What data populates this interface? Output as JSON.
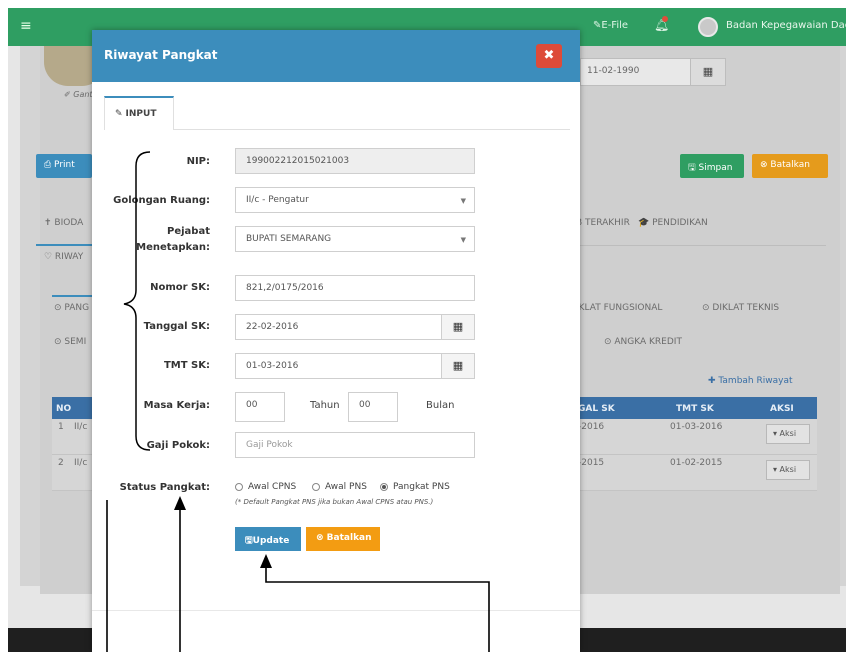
{
  "topbar": {
    "menu_icon": "hamburger-icon",
    "efile_label": "✎E-File",
    "bell_icon": "bell-icon",
    "org_name": "Badan Kepegawaian Daerah"
  },
  "background": {
    "ganti_label": "✐ Gant",
    "date_value": "11-02-1990",
    "print_label": "⎙ Print",
    "simpan_label": "🖫 Simpan",
    "batalkan_label": "⊗ Batalkan",
    "tabs_row1": {
      "biodata": "✝ BIODA",
      "terakhir": "B TERAKHIR",
      "pendidikan": "🎓 PENDIDIKAN"
    },
    "tabs_row2": {
      "riwayat": "♡ RIWAY"
    },
    "tabs_row3": {
      "pangkat": "⊙ PANG",
      "diklat_fungsional": "IKLAT FUNGSIONAL",
      "diklat_teknis": "⊙ DIKLAT TEKNIS"
    },
    "tabs_row4": {
      "seminar": "⊙ SEMI",
      "angka_kredit": "⊙ ANGKA KREDIT"
    },
    "tambah_riwayat": "✚ Tambah Riwayat",
    "table_headers": {
      "no": "NO",
      "tgl_sk": "GAL SK",
      "tmt_sk": "TMT SK",
      "aksi": "AKSI"
    },
    "rows": [
      {
        "no": "1",
        "gol": "II/c",
        "tgl": "-2016",
        "tmt": "01-03-2016",
        "aksi": "▾ Aksi"
      },
      {
        "no": "2",
        "gol": "II/c",
        "tgl": "-2015",
        "tmt": "01-02-2015",
        "aksi": "▾ Aksi"
      }
    ]
  },
  "modal": {
    "title": "Riwayat Pangkat",
    "close_label": "✖",
    "tab_input": "INPUT",
    "fields": {
      "nip": {
        "label": "NIP:",
        "value": "199002212015021003"
      },
      "golongan": {
        "label": "Golongan Ruang:",
        "value": "II/c - Pengatur"
      },
      "pejabat": {
        "label_line1": "Pejabat",
        "label_line2": "Menetapkan:",
        "value": "BUPATI SEMARANG"
      },
      "nomor_sk": {
        "label": "Nomor SK:",
        "value": "821,2/0175/2016"
      },
      "tanggal_sk": {
        "label": "Tanggal SK:",
        "value": "22-02-2016"
      },
      "tmt_sk": {
        "label": "TMT SK:",
        "value": "01-03-2016"
      },
      "masa_kerja": {
        "label": "Masa Kerja:",
        "tahun_value": "00",
        "tahun_label": "Tahun",
        "bulan_value": "00",
        "bulan_label": "Bulan"
      },
      "gaji_pokok": {
        "label": "Gaji Pokok:",
        "placeholder": "Gaji Pokok"
      },
      "status_pangkat": {
        "label": "Status Pangkat:",
        "options": [
          "Awal CPNS",
          "Awal PNS",
          "Pangkat PNS"
        ],
        "selected": "Pangkat PNS",
        "hint": "(* Default Pangkat PNS jika bukan Awal CPNS atau PNS.)"
      }
    },
    "update_label": "🖫Update",
    "batalkan_label": "⊗ Batalkan"
  },
  "colors": {
    "primary": "#3c8dbc",
    "success": "#2f9e62",
    "warning": "#f39c12",
    "danger": "#dd4b39"
  }
}
